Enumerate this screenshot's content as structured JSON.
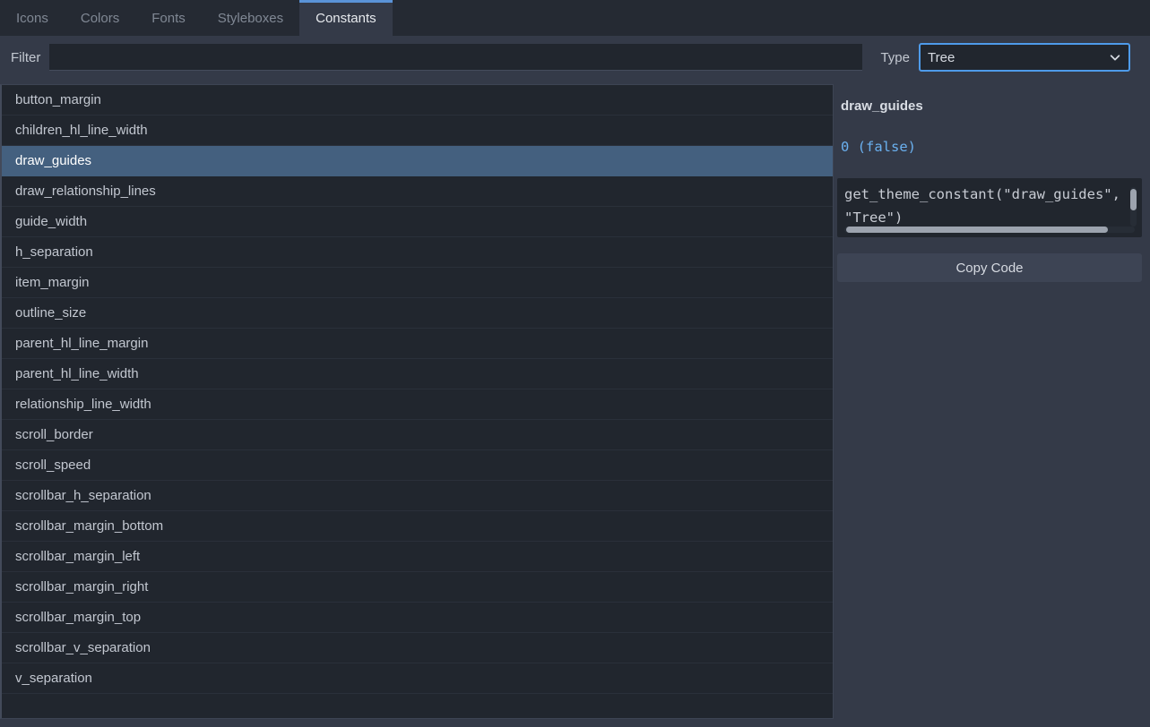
{
  "tabs": [
    {
      "label": "Icons",
      "active": false
    },
    {
      "label": "Colors",
      "active": false
    },
    {
      "label": "Fonts",
      "active": false
    },
    {
      "label": "Styleboxes",
      "active": false
    },
    {
      "label": "Constants",
      "active": true
    }
  ],
  "filter": {
    "label": "Filter",
    "value": "",
    "placeholder": ""
  },
  "type": {
    "label": "Type",
    "selected": "Tree",
    "options": [
      "Tree"
    ],
    "icon": "chevron-down-icon"
  },
  "list": {
    "selected_index": 2,
    "items": [
      "button_margin",
      "children_hl_line_width",
      "draw_guides",
      "draw_relationship_lines",
      "guide_width",
      "h_separation",
      "item_margin",
      "outline_size",
      "parent_hl_line_margin",
      "parent_hl_line_width",
      "relationship_line_width",
      "scroll_border",
      "scroll_speed",
      "scrollbar_h_separation",
      "scrollbar_margin_bottom",
      "scrollbar_margin_left",
      "scrollbar_margin_right",
      "scrollbar_margin_top",
      "scrollbar_v_separation",
      "v_separation"
    ]
  },
  "detail": {
    "title": "draw_guides",
    "value": "0 (false)",
    "code": "get_theme_constant(\"draw_guides\", \"Tree\")",
    "copy_label": "Copy Code"
  },
  "colors": {
    "accent": "#5a93d8",
    "focus_border": "#4e9bea",
    "selection": "#44607f",
    "value_text": "#6ab0ef",
    "panel_bg": "#343a48",
    "list_bg": "#21262e",
    "tabbar_bg": "#252a33"
  }
}
